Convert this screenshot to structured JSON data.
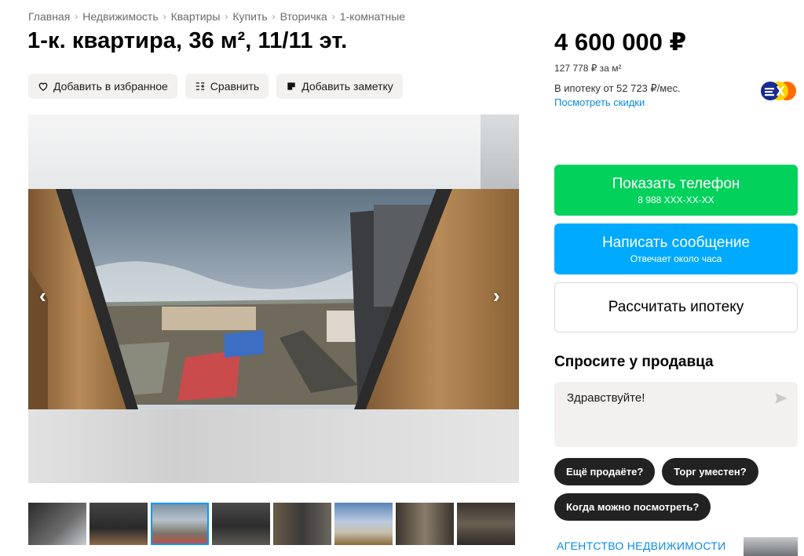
{
  "breadcrumb": [
    "Главная",
    "Недвижимость",
    "Квартиры",
    "Купить",
    "Вторичка",
    "1-комнатные"
  ],
  "title": "1-к. квартира, 36 м², 11/11 эт.",
  "actions": {
    "favorite": "Добавить в избранное",
    "compare": "Сравнить",
    "note": "Добавить заметку"
  },
  "gallery": {
    "prev_icon": "chevron-left-icon",
    "next_icon": "chevron-right-icon",
    "prev_glyph": "‹",
    "next_glyph": "›",
    "thumbnail_count": 8,
    "active_thumbnail": 3
  },
  "price": {
    "total": "4 600 000 ₽",
    "per_m2": "127 778 ₽ за м²",
    "mortgage": "В ипотеку от 52 723 ₽/мес.",
    "discounts": "Посмотреть скидки"
  },
  "buttons": {
    "phone_label": "Показать телефон",
    "phone_number": "8 988 XXX-XX-XX",
    "message_label": "Написать сообщение",
    "message_sub": "Отвечает около часа",
    "mortgage_calc": "Рассчитать ипотеку"
  },
  "ask": {
    "title": "Спросите у продавца",
    "message": "Здравствуйте!",
    "chips": [
      "Ещё продаёте?",
      "Торг уместен?",
      "Когда можно посмотреть?"
    ]
  },
  "agency": "АГЕНТСТВО НЕДВИЖИМОСТИ",
  "colors": {
    "phone_button": "#02d15c",
    "message_button": "#00aaff",
    "link": "#0a8ce6"
  }
}
